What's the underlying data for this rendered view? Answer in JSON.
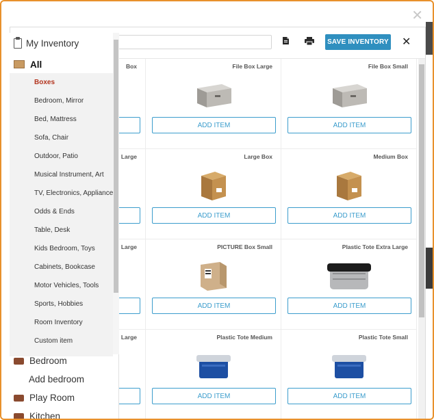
{
  "modal": {
    "close_glyph": "✕"
  },
  "toolbar": {
    "search_placeholder": "",
    "doc_icon": "document-icon",
    "print_icon": "print-icon",
    "save_label": "SAVE INVENTORY",
    "close_glyph": "✕",
    "accent": "#2f8fbf"
  },
  "sidebar": {
    "header": "My Inventory",
    "all_label": "All",
    "categories": [
      "Boxes",
      "Bedroom, Mirror",
      "Bed, Mattress",
      "Sofa, Chair",
      "Outdoor, Patio",
      "Musical Instrument, Art",
      "TV, Electronics, Appliance",
      "Odds & Ends",
      "Table, Desk",
      "Kids Bedroom, Toys",
      "Cabinets, Bookcase",
      "Motor Vehicles, Tools",
      "Sports, Hobbies",
      "Room Inventory",
      "Custom item"
    ],
    "active_category": "Boxes",
    "rooms": {
      "bedroom": "Bedroom",
      "add_bedroom": "Add bedroom",
      "play_room": "Play Room",
      "kitchen": "Kitchen"
    }
  },
  "grid": {
    "add_label": "ADD ITEM",
    "rows": [
      [
        "Box",
        "File Box Large",
        "File Box Small"
      ],
      [
        "Large",
        "Large Box",
        "Medium Box"
      ],
      [
        "Large",
        "PICTURE Box Small",
        "Plastic Tote Extra Large"
      ],
      [
        "Large",
        "Plastic Tote Medium",
        "Plastic Tote Small"
      ]
    ]
  }
}
